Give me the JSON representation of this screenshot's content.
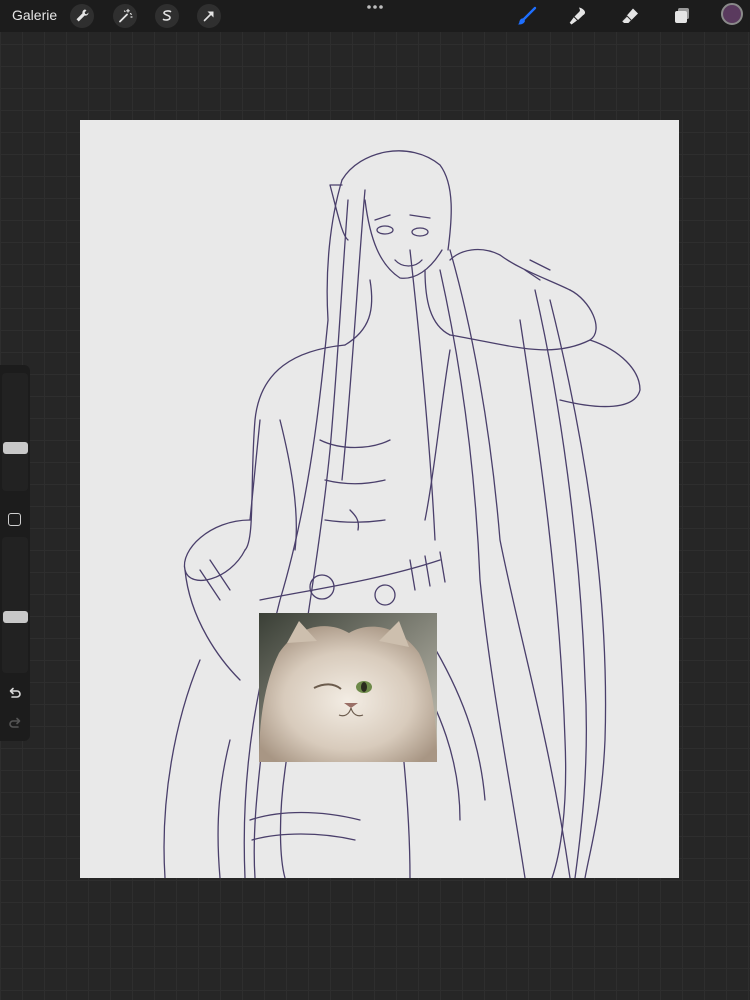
{
  "topbar": {
    "gallery_label": "Galerie",
    "tools_left": [
      "wrench-icon",
      "magic-wand-icon",
      "selection-icon",
      "transform-arrow-icon"
    ],
    "tools_right": [
      "brush-icon",
      "smudge-icon",
      "eraser-icon",
      "layers-icon"
    ],
    "active_tool": "brush-icon",
    "active_tool_color": "#1e6fff",
    "current_color": "#5a3a5e"
  },
  "sidebar": {
    "size_level": 0.35,
    "opacity_level": 0.4
  },
  "canvas": {
    "paper_color": "#e9e9e9",
    "line_color": "#4a3f6b"
  }
}
